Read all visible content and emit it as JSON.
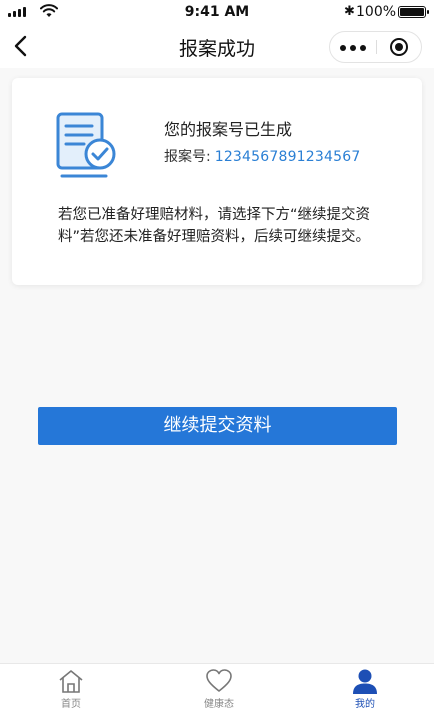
{
  "status_bar": {
    "time": "9:41 AM",
    "battery_percent": "100%",
    "battery_level": 1.0,
    "bluetooth_glyph": "✱"
  },
  "nav": {
    "title": "报案成功",
    "back_icon": "chevron-left-icon",
    "more_icon": "more-dots-icon",
    "close_icon": "target-icon"
  },
  "card": {
    "heading": "您的报案号已生成",
    "case_label": "报案号:",
    "case_number": "1234567891234567",
    "description": "若您已准备好理赔材料，请选择下方“继续提交资料”若您还未准备好理赔资料，后续可继续提交。",
    "icon": "document-check-icon"
  },
  "primary_button": {
    "label": "继续提交资料"
  },
  "tabs": [
    {
      "label": "首页",
      "icon": "home-icon",
      "active": false
    },
    {
      "label": "健康态",
      "icon": "heart-icon",
      "active": false
    },
    {
      "label": "我的",
      "icon": "user-icon",
      "active": true
    }
  ],
  "colors": {
    "accent": "#2577d8",
    "case_number": "#2a7fd4",
    "active_tab": "#1d4fb5"
  }
}
